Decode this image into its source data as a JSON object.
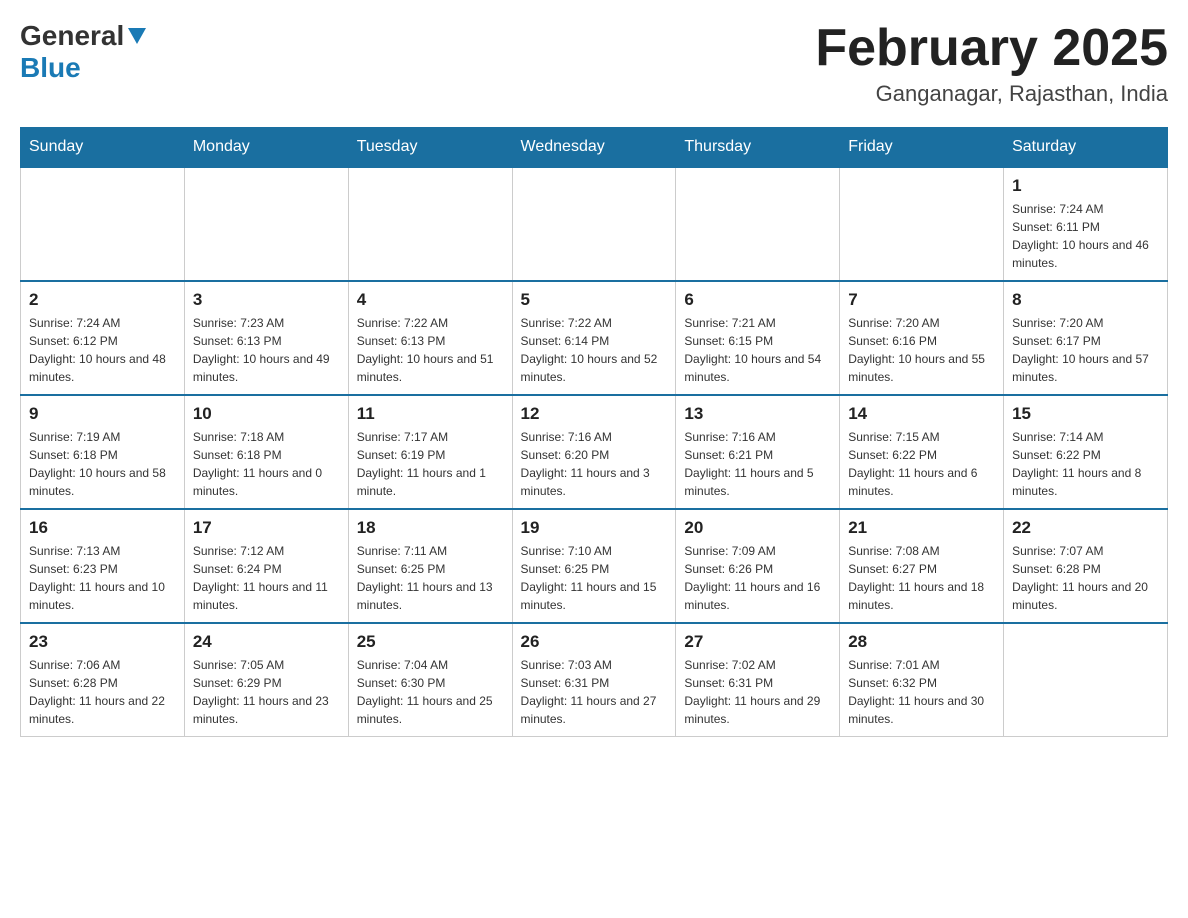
{
  "header": {
    "logo": {
      "general": "General",
      "blue": "Blue",
      "arrow": "▼"
    },
    "title": "February 2025",
    "location": "Ganganagar, Rajasthan, India"
  },
  "days_of_week": [
    "Sunday",
    "Monday",
    "Tuesday",
    "Wednesday",
    "Thursday",
    "Friday",
    "Saturday"
  ],
  "weeks": [
    [
      {
        "day": "",
        "sunrise": "",
        "sunset": "",
        "daylight": ""
      },
      {
        "day": "",
        "sunrise": "",
        "sunset": "",
        "daylight": ""
      },
      {
        "day": "",
        "sunrise": "",
        "sunset": "",
        "daylight": ""
      },
      {
        "day": "",
        "sunrise": "",
        "sunset": "",
        "daylight": ""
      },
      {
        "day": "",
        "sunrise": "",
        "sunset": "",
        "daylight": ""
      },
      {
        "day": "",
        "sunrise": "",
        "sunset": "",
        "daylight": ""
      },
      {
        "day": "1",
        "sunrise": "Sunrise: 7:24 AM",
        "sunset": "Sunset: 6:11 PM",
        "daylight": "Daylight: 10 hours and 46 minutes."
      }
    ],
    [
      {
        "day": "2",
        "sunrise": "Sunrise: 7:24 AM",
        "sunset": "Sunset: 6:12 PM",
        "daylight": "Daylight: 10 hours and 48 minutes."
      },
      {
        "day": "3",
        "sunrise": "Sunrise: 7:23 AM",
        "sunset": "Sunset: 6:13 PM",
        "daylight": "Daylight: 10 hours and 49 minutes."
      },
      {
        "day": "4",
        "sunrise": "Sunrise: 7:22 AM",
        "sunset": "Sunset: 6:13 PM",
        "daylight": "Daylight: 10 hours and 51 minutes."
      },
      {
        "day": "5",
        "sunrise": "Sunrise: 7:22 AM",
        "sunset": "Sunset: 6:14 PM",
        "daylight": "Daylight: 10 hours and 52 minutes."
      },
      {
        "day": "6",
        "sunrise": "Sunrise: 7:21 AM",
        "sunset": "Sunset: 6:15 PM",
        "daylight": "Daylight: 10 hours and 54 minutes."
      },
      {
        "day": "7",
        "sunrise": "Sunrise: 7:20 AM",
        "sunset": "Sunset: 6:16 PM",
        "daylight": "Daylight: 10 hours and 55 minutes."
      },
      {
        "day": "8",
        "sunrise": "Sunrise: 7:20 AM",
        "sunset": "Sunset: 6:17 PM",
        "daylight": "Daylight: 10 hours and 57 minutes."
      }
    ],
    [
      {
        "day": "9",
        "sunrise": "Sunrise: 7:19 AM",
        "sunset": "Sunset: 6:18 PM",
        "daylight": "Daylight: 10 hours and 58 minutes."
      },
      {
        "day": "10",
        "sunrise": "Sunrise: 7:18 AM",
        "sunset": "Sunset: 6:18 PM",
        "daylight": "Daylight: 11 hours and 0 minutes."
      },
      {
        "day": "11",
        "sunrise": "Sunrise: 7:17 AM",
        "sunset": "Sunset: 6:19 PM",
        "daylight": "Daylight: 11 hours and 1 minute."
      },
      {
        "day": "12",
        "sunrise": "Sunrise: 7:16 AM",
        "sunset": "Sunset: 6:20 PM",
        "daylight": "Daylight: 11 hours and 3 minutes."
      },
      {
        "day": "13",
        "sunrise": "Sunrise: 7:16 AM",
        "sunset": "Sunset: 6:21 PM",
        "daylight": "Daylight: 11 hours and 5 minutes."
      },
      {
        "day": "14",
        "sunrise": "Sunrise: 7:15 AM",
        "sunset": "Sunset: 6:22 PM",
        "daylight": "Daylight: 11 hours and 6 minutes."
      },
      {
        "day": "15",
        "sunrise": "Sunrise: 7:14 AM",
        "sunset": "Sunset: 6:22 PM",
        "daylight": "Daylight: 11 hours and 8 minutes."
      }
    ],
    [
      {
        "day": "16",
        "sunrise": "Sunrise: 7:13 AM",
        "sunset": "Sunset: 6:23 PM",
        "daylight": "Daylight: 11 hours and 10 minutes."
      },
      {
        "day": "17",
        "sunrise": "Sunrise: 7:12 AM",
        "sunset": "Sunset: 6:24 PM",
        "daylight": "Daylight: 11 hours and 11 minutes."
      },
      {
        "day": "18",
        "sunrise": "Sunrise: 7:11 AM",
        "sunset": "Sunset: 6:25 PM",
        "daylight": "Daylight: 11 hours and 13 minutes."
      },
      {
        "day": "19",
        "sunrise": "Sunrise: 7:10 AM",
        "sunset": "Sunset: 6:25 PM",
        "daylight": "Daylight: 11 hours and 15 minutes."
      },
      {
        "day": "20",
        "sunrise": "Sunrise: 7:09 AM",
        "sunset": "Sunset: 6:26 PM",
        "daylight": "Daylight: 11 hours and 16 minutes."
      },
      {
        "day": "21",
        "sunrise": "Sunrise: 7:08 AM",
        "sunset": "Sunset: 6:27 PM",
        "daylight": "Daylight: 11 hours and 18 minutes."
      },
      {
        "day": "22",
        "sunrise": "Sunrise: 7:07 AM",
        "sunset": "Sunset: 6:28 PM",
        "daylight": "Daylight: 11 hours and 20 minutes."
      }
    ],
    [
      {
        "day": "23",
        "sunrise": "Sunrise: 7:06 AM",
        "sunset": "Sunset: 6:28 PM",
        "daylight": "Daylight: 11 hours and 22 minutes."
      },
      {
        "day": "24",
        "sunrise": "Sunrise: 7:05 AM",
        "sunset": "Sunset: 6:29 PM",
        "daylight": "Daylight: 11 hours and 23 minutes."
      },
      {
        "day": "25",
        "sunrise": "Sunrise: 7:04 AM",
        "sunset": "Sunset: 6:30 PM",
        "daylight": "Daylight: 11 hours and 25 minutes."
      },
      {
        "day": "26",
        "sunrise": "Sunrise: 7:03 AM",
        "sunset": "Sunset: 6:31 PM",
        "daylight": "Daylight: 11 hours and 27 minutes."
      },
      {
        "day": "27",
        "sunrise": "Sunrise: 7:02 AM",
        "sunset": "Sunset: 6:31 PM",
        "daylight": "Daylight: 11 hours and 29 minutes."
      },
      {
        "day": "28",
        "sunrise": "Sunrise: 7:01 AM",
        "sunset": "Sunset: 6:32 PM",
        "daylight": "Daylight: 11 hours and 30 minutes."
      },
      {
        "day": "",
        "sunrise": "",
        "sunset": "",
        "daylight": ""
      }
    ]
  ]
}
